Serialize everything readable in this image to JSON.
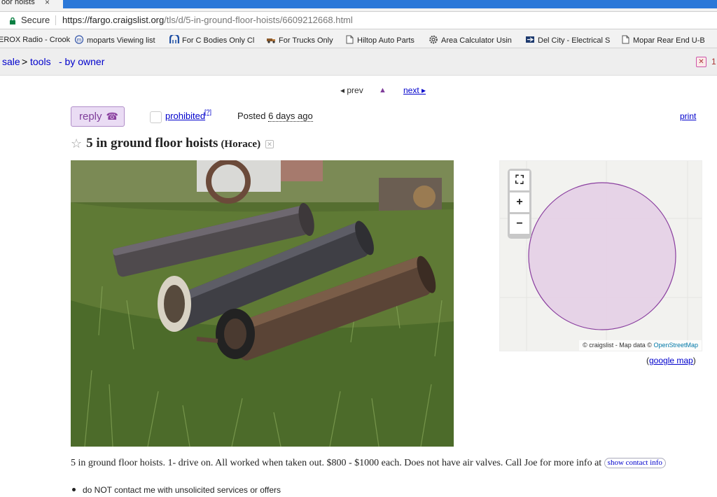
{
  "browser": {
    "tab_title": "oor hoists",
    "tab_close": "×",
    "secure_label": "Secure",
    "url_host": "https://fargo.craigslist.org",
    "url_path": "/tls/d/5-in-ground-floor-hoists/6609212668.html",
    "bookmarks": [
      {
        "label": "EROX Radio - Crook",
        "icon": "radio-icon"
      },
      {
        "label": "moparts Viewing list",
        "icon": "moparts-icon"
      },
      {
        "label": "For C Bodies Only Cl",
        "icon": "mopar-logo-icon"
      },
      {
        "label": "For Trucks Only",
        "icon": "truck-icon"
      },
      {
        "label": "Hiltop Auto Parts",
        "icon": "page-icon"
      },
      {
        "label": "Area Calculator Usin",
        "icon": "gear-icon"
      },
      {
        "label": "Del City - Electrical S",
        "icon": "delcity-icon"
      },
      {
        "label": "Mopar Rear End U-B",
        "icon": "page-icon"
      }
    ]
  },
  "breadcrumbs": {
    "sale": "sale",
    "sep": ">",
    "tools": "tools",
    "owner": "- by owner",
    "fav_count": "1"
  },
  "nav": {
    "prev": "◂ prev",
    "up": "▲",
    "next": "next ▸"
  },
  "actions": {
    "reply": "reply",
    "prohibited": "prohibited",
    "prohibited_help": "[?]",
    "posted_label": "Posted",
    "posted_ago": "6 days ago",
    "print": "print"
  },
  "posting": {
    "star": "☆",
    "title": "5 in ground floor hoists",
    "location": "(Horace)",
    "body": "5 in ground floor hoists. 1- drive on. All worked when taken out. $800 - $1000 each. Does not have air valves. Call Joe for more info at",
    "show_contact": "show contact info",
    "notice": "do NOT contact me with unsolicited services or offers"
  },
  "map": {
    "fullscreen": "⛶",
    "zoom_in": "+",
    "zoom_out": "−",
    "attribution_prefix": "© craigslist - Map data ©",
    "attribution_osm": "OpenStreetMap",
    "google_open": "(",
    "google_link": "google map",
    "google_close": ")",
    "circle_color": "#8a3f9f"
  }
}
